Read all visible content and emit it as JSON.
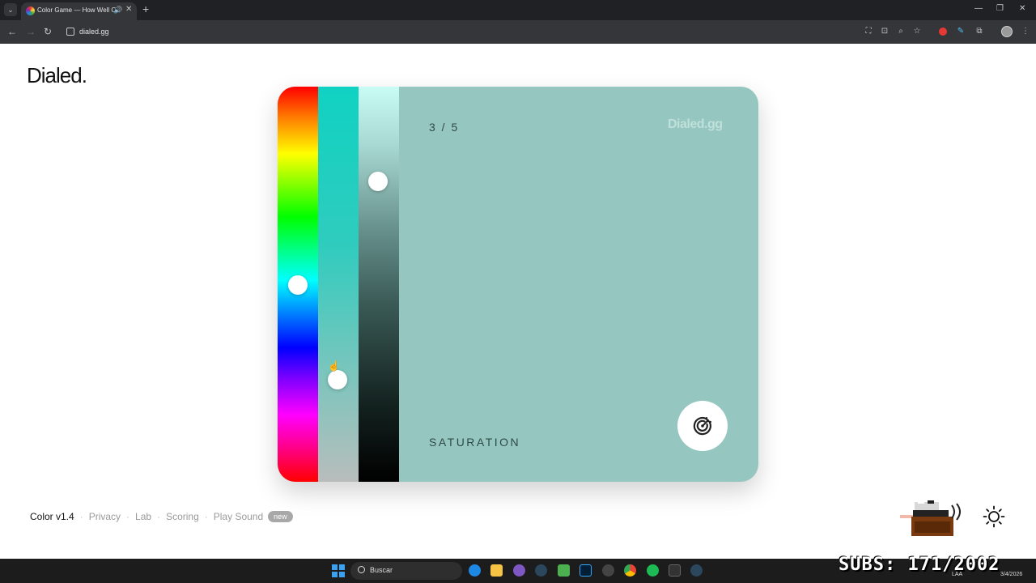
{
  "browser": {
    "tab_title": "Color Game — How Well C",
    "tab_audio_icon": "speaker-icon",
    "new_tab_label": "+",
    "url": "dialed.gg",
    "window_controls": [
      "—",
      "❐",
      "✕"
    ]
  },
  "page": {
    "logo": "Dialed.",
    "card": {
      "counter": "3 / 5",
      "watermark": "Dialed.gg",
      "mode_label": "SATURATION",
      "color": "#95c6bf",
      "hue_level": 0.5,
      "saturation_level": 0.74,
      "lightness_level": 0.24
    },
    "footer": {
      "version": "Color v1.4",
      "links": [
        "Privacy",
        "Lab",
        "Scoring",
        "Play Sound"
      ],
      "badge": "new"
    }
  },
  "taskbar": {
    "search_placeholder": "Buscar",
    "overlay_text": "SUBS: 171/2002",
    "tray_lang": "LAA",
    "tray_date": "3/4/2026"
  }
}
